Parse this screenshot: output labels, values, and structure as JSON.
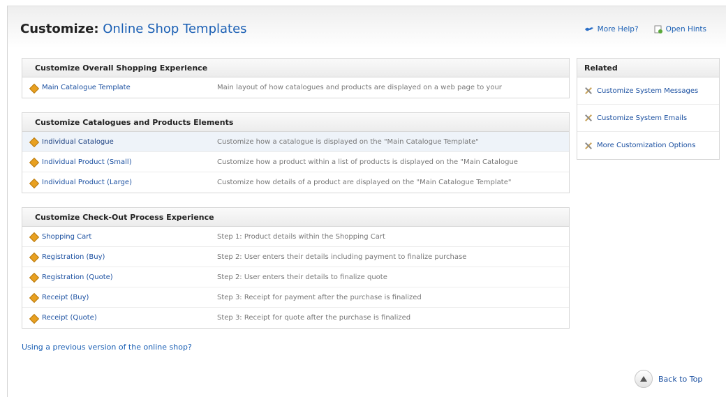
{
  "header": {
    "title_label": "Customize:",
    "title_subject": "Online Shop Templates"
  },
  "help": {
    "more_help": "More Help?",
    "open_hints": "Open Hints"
  },
  "sections": [
    {
      "heading": "Customize Overall Shopping Experience",
      "rows": [
        {
          "name": "Main Catalogue Template",
          "desc": "Main layout of how catalogues and products are displayed on a web page to your"
        }
      ]
    },
    {
      "heading": "Customize Catalogues and Products Elements",
      "rows": [
        {
          "name": "Individual Catalogue",
          "desc": "Customize how a catalogue is displayed on the \"Main Catalogue Template\""
        },
        {
          "name": "Individual Product (Small)",
          "desc": "Customize how a product within a list of products is displayed on the \"Main Catalogue"
        },
        {
          "name": "Individual Product (Large)",
          "desc": "Customize how details of a product are displayed on the \"Main Catalogue Template\""
        }
      ]
    },
    {
      "heading": "Customize Check-Out Process Experience",
      "rows": [
        {
          "name": "Shopping Cart",
          "desc": "Step 1: Product details within the Shopping Cart"
        },
        {
          "name": "Registration (Buy)",
          "desc": "Step 2: User enters their details including payment to finalize purchase"
        },
        {
          "name": "Registration (Quote)",
          "desc": "Step 2: User enters their details to finalize quote"
        },
        {
          "name": "Receipt (Buy)",
          "desc": "Step 3: Receipt for payment after the purchase is finalized"
        },
        {
          "name": "Receipt (Quote)",
          "desc": "Step 3: Receipt for quote after the purchase is finalized"
        }
      ]
    }
  ],
  "related": {
    "heading": "Related",
    "items": [
      "Customize System Messages",
      "Customize System Emails",
      "More Customization Options"
    ]
  },
  "footer": {
    "previous_version_link": "Using a previous version of the online shop?",
    "back_to_top": "Back to Top"
  },
  "colors": {
    "link": "#1a5fb4",
    "icon_diamond": "#e8a020",
    "row_highlight": "#eef3f9"
  },
  "icons": {
    "row_icon": "diamond-icon",
    "related_icon": "tools-icon",
    "help_icon": "bird-icon",
    "hints_icon": "hints-icon",
    "back_to_top_icon": "arrow-up-icon"
  }
}
